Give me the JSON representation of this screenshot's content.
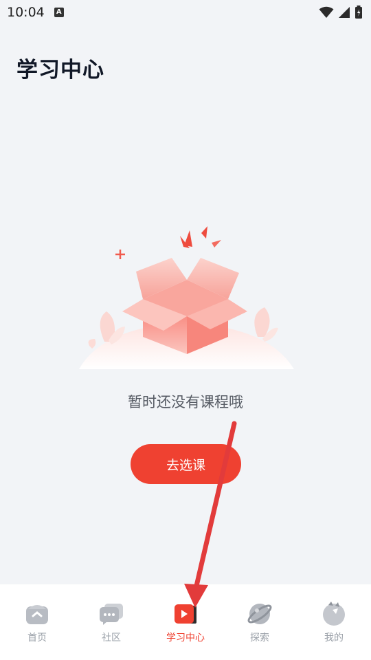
{
  "status_bar": {
    "time": "10:04",
    "notification_icon": "a-icon"
  },
  "page": {
    "title": "学习中心"
  },
  "empty_state": {
    "illustration": "open-box-icon",
    "message": "暂时还没有课程哦",
    "button_label": "去选课"
  },
  "tabs": [
    {
      "label": "首页",
      "icon": "home-icon",
      "active": false
    },
    {
      "label": "社区",
      "icon": "chat-icon",
      "active": false
    },
    {
      "label": "学习中心",
      "icon": "play-icon",
      "active": true
    },
    {
      "label": "探索",
      "icon": "planet-icon",
      "active": false
    },
    {
      "label": "我的",
      "icon": "profile-icon",
      "active": false
    }
  ],
  "colors": {
    "accent": "#ef4131",
    "background": "#f2f4f7",
    "inactive_tab": "#9aa0a8",
    "annotation_arrow": "#e23b3b"
  }
}
